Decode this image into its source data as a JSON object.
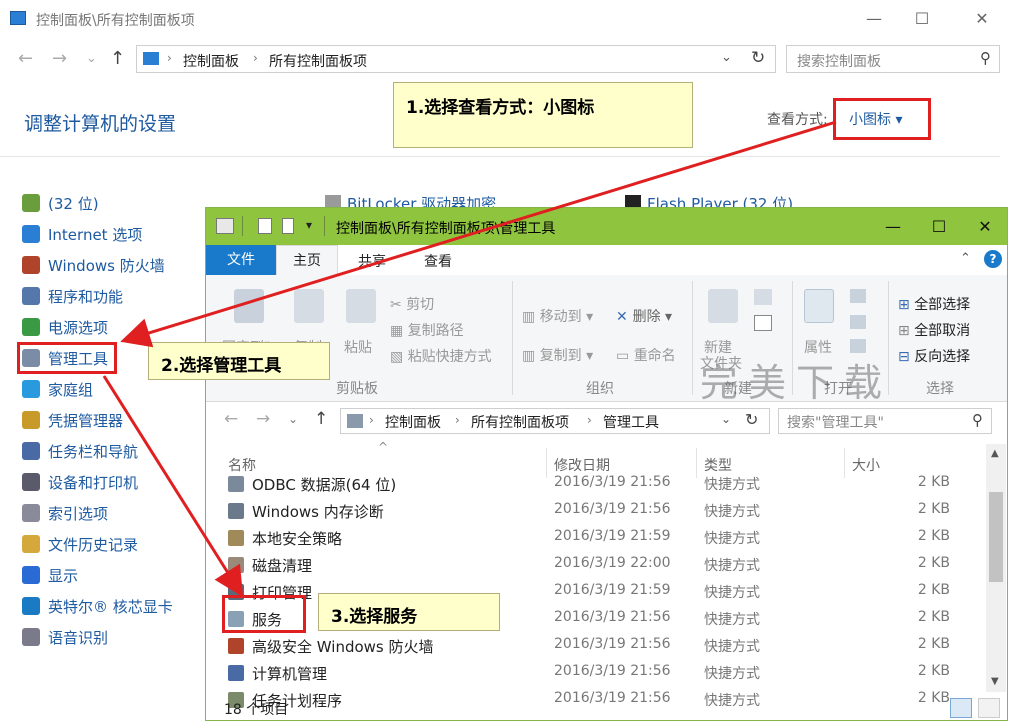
{
  "control_panel": {
    "window_title": "控制面板\\所有控制面板项",
    "window_buttons": [
      "—",
      "☐",
      "✕"
    ],
    "nav": {
      "back": "←",
      "forward": "→",
      "dropdown": "⌄",
      "up": "↑"
    },
    "breadcrumb": [
      "控制面板",
      "所有控制面板项"
    ],
    "search_placeholder": "搜索控制面板",
    "heading": "调整计算机的设置",
    "view_by_label": "查看方式:",
    "view_by_value": "小图标 ▾",
    "top_row_items": [
      "BitLocker 驱动器加密",
      "Flash Player (32 位)"
    ],
    "items": [
      {
        "label": "(32 位)",
        "color": "#6a9e3c"
      },
      {
        "label": "Internet 选项",
        "color": "#2a7fd4"
      },
      {
        "label": "Windows 防火墙",
        "color": "#b0442a"
      },
      {
        "label": "程序和功能",
        "color": "#5577aa"
      },
      {
        "label": "电源选项",
        "color": "#3a9a44"
      },
      {
        "label": "管理工具",
        "color": "#7a8ca6"
      },
      {
        "label": "家庭组",
        "color": "#2a9adf"
      },
      {
        "label": "凭据管理器",
        "color": "#c89a2a"
      },
      {
        "label": "任务栏和导航",
        "color": "#4a6aa6"
      },
      {
        "label": "设备和打印机",
        "color": "#5a5a6a"
      },
      {
        "label": "索引选项",
        "color": "#8a8a9a"
      },
      {
        "label": "文件历史记录",
        "color": "#d4a83a"
      },
      {
        "label": "显示",
        "color": "#2a6ad4"
      },
      {
        "label": "英特尔® 核芯显卡",
        "color": "#1a7ac4"
      },
      {
        "label": "语音识别",
        "color": "#7a7a8a"
      }
    ]
  },
  "explorer": {
    "window_title": "控制面板\\所有控制面板项\\管理工具",
    "window_buttons": [
      "—",
      "☐",
      "✕"
    ],
    "tabs": [
      "文件",
      "主页",
      "共享",
      "查看"
    ],
    "ribbon": {
      "pin": "固定到\"",
      "copy": "复制",
      "paste": "粘贴",
      "cut": "剪切",
      "copy_path": "复制路径",
      "paste_shortcut": "粘贴快捷方式",
      "move_to": "移动到",
      "copy_to": "复制到",
      "delete": "删除",
      "rename": "重命名",
      "new": "新建",
      "new_folder": "文件夹",
      "properties": "属性",
      "select_all": "全部选择",
      "select_none": "全部取消",
      "invert": "反向选择",
      "groups": [
        "剪贴板",
        "组织",
        "新建",
        "打开",
        "选择"
      ]
    },
    "breadcrumb": [
      "控制面板",
      "所有控制面板项",
      "管理工具"
    ],
    "search_placeholder": "搜索\"管理工具\"",
    "columns": [
      "名称",
      "修改日期",
      "类型",
      "大小"
    ],
    "rows": [
      {
        "name": "ODBC 数据源(64 位)",
        "date": "2016/3/19 21:56",
        "type": "快捷方式",
        "size": "2 KB",
        "color": "#7a8a9a"
      },
      {
        "name": "Windows 内存诊断",
        "date": "2016/3/19 21:56",
        "type": "快捷方式",
        "size": "2 KB",
        "color": "#6a7a8a"
      },
      {
        "name": "本地安全策略",
        "date": "2016/3/19 21:59",
        "type": "快捷方式",
        "size": "2 KB",
        "color": "#a08a5a"
      },
      {
        "name": "磁盘清理",
        "date": "2016/3/19 22:00",
        "type": "快捷方式",
        "size": "2 KB",
        "color": "#9a8a7a"
      },
      {
        "name": "打印管理",
        "date": "2016/3/19 21:59",
        "type": "快捷方式",
        "size": "2 KB",
        "color": "#5a6a7a"
      },
      {
        "name": "服务",
        "date": "2016/3/19 21:56",
        "type": "快捷方式",
        "size": "2 KB",
        "color": "#8aa0b4"
      },
      {
        "name": "高级安全 Windows 防火墙",
        "date": "2016/3/19 21:56",
        "type": "快捷方式",
        "size": "2 KB",
        "color": "#b0442a"
      },
      {
        "name": "计算机管理",
        "date": "2016/3/19 21:56",
        "type": "快捷方式",
        "size": "2 KB",
        "color": "#4a6aa6"
      },
      {
        "name": "任务计划程序",
        "date": "2016/3/19 21:56",
        "type": "快捷方式",
        "size": "2 KB",
        "color": "#7a8a6a"
      }
    ],
    "status": "18 个项目"
  },
  "annotations": {
    "step1": "1.选择查看方式：小图标",
    "step2": "2.选择管理工具",
    "step3": "3.选择服务",
    "arrow_color": "#e02020",
    "watermark": "完美下载"
  }
}
